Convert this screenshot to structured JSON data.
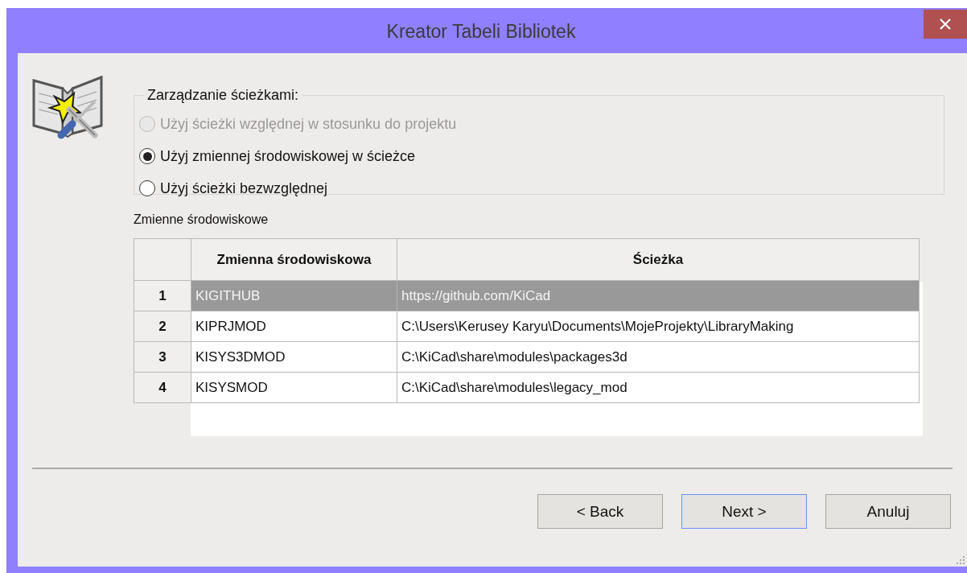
{
  "window": {
    "title": "Kreator Tabeli Bibliotek"
  },
  "path_management": {
    "legend": "Zarządzanie ścieżkami:",
    "options": [
      {
        "label": "Użyj ścieżki względnej w stosunku do projektu",
        "selected": false,
        "disabled": true
      },
      {
        "label": "Użyj zmiennej środowiskowej w ścieżce",
        "selected": true,
        "disabled": false
      },
      {
        "label": "Użyj ścieżki bezwzględnej",
        "selected": false,
        "disabled": false
      }
    ]
  },
  "env_table": {
    "label": "Zmienne środowiskowe",
    "columns": [
      "Zmienna środowiskowa",
      "Ścieżka"
    ],
    "rows": [
      {
        "number": "1",
        "cells": [
          "KIGITHUB",
          "https://github.com/KiCad"
        ],
        "selected": true
      },
      {
        "number": "2",
        "cells": [
          "KIPRJMOD",
          "C:\\Users\\Kerusey Karyu\\Documents\\MojeProjekty\\LibraryMaking"
        ],
        "selected": false
      },
      {
        "number": "3",
        "cells": [
          "KISYS3DMOD",
          "C:\\KiCad\\share\\modules\\packages3d"
        ],
        "selected": false
      },
      {
        "number": "4",
        "cells": [
          "KISYSMOD",
          "C:\\KiCad\\share\\modules\\legacy_mod"
        ],
        "selected": false
      }
    ]
  },
  "buttons": [
    {
      "label": "< Back",
      "focused": false
    },
    {
      "label": "Next >",
      "focused": true
    },
    {
      "label": "Anuluj",
      "focused": false
    }
  ]
}
